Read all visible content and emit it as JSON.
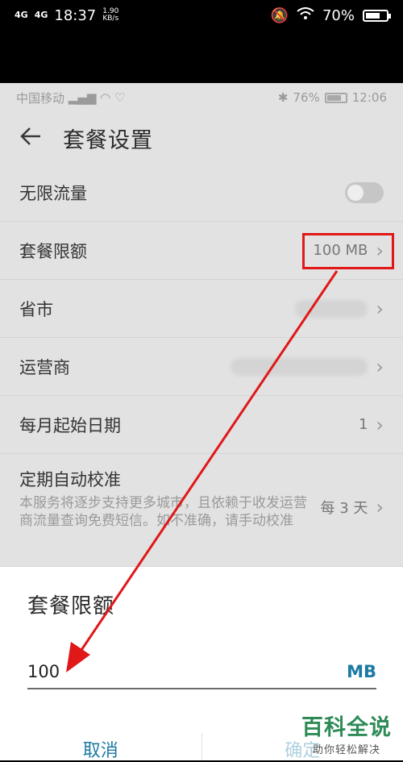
{
  "outer_status": {
    "signal_1": "4G",
    "signal_2": "4G",
    "time": "18:37",
    "net_speed": "1.90",
    "net_unit": "KB/s",
    "battery": "70%",
    "battery_level": 0.7
  },
  "inner_status": {
    "carrier": "中国移动",
    "bt_battery": "76%",
    "time": "12:06"
  },
  "header": {
    "title": "套餐设置"
  },
  "settings": {
    "unlimited": {
      "label": "无限流量",
      "enabled": false
    },
    "limit": {
      "label": "套餐限额",
      "value": "100 MB"
    },
    "province": {
      "label": "省市"
    },
    "carrier": {
      "label": "运营商"
    },
    "start_date": {
      "label": "每月起始日期",
      "value": "1"
    },
    "auto_calibrate": {
      "label": "定期自动校准",
      "desc": "本服务将逐步支持更多城市，且依赖于收发运营商流量查询免费短信。如不准确，请手动校准",
      "value": "每 3 天"
    }
  },
  "dialog": {
    "title": "套餐限额",
    "input_value": "100",
    "unit": "MB",
    "cancel_label": "取消",
    "confirm_label": "确定"
  },
  "watermark": {
    "title": "百科全说",
    "subtitle": "助你轻松解决"
  },
  "colors": {
    "accent": "#1b7aa5",
    "annotation": "#e01818",
    "watermark": "#2e8b57"
  }
}
